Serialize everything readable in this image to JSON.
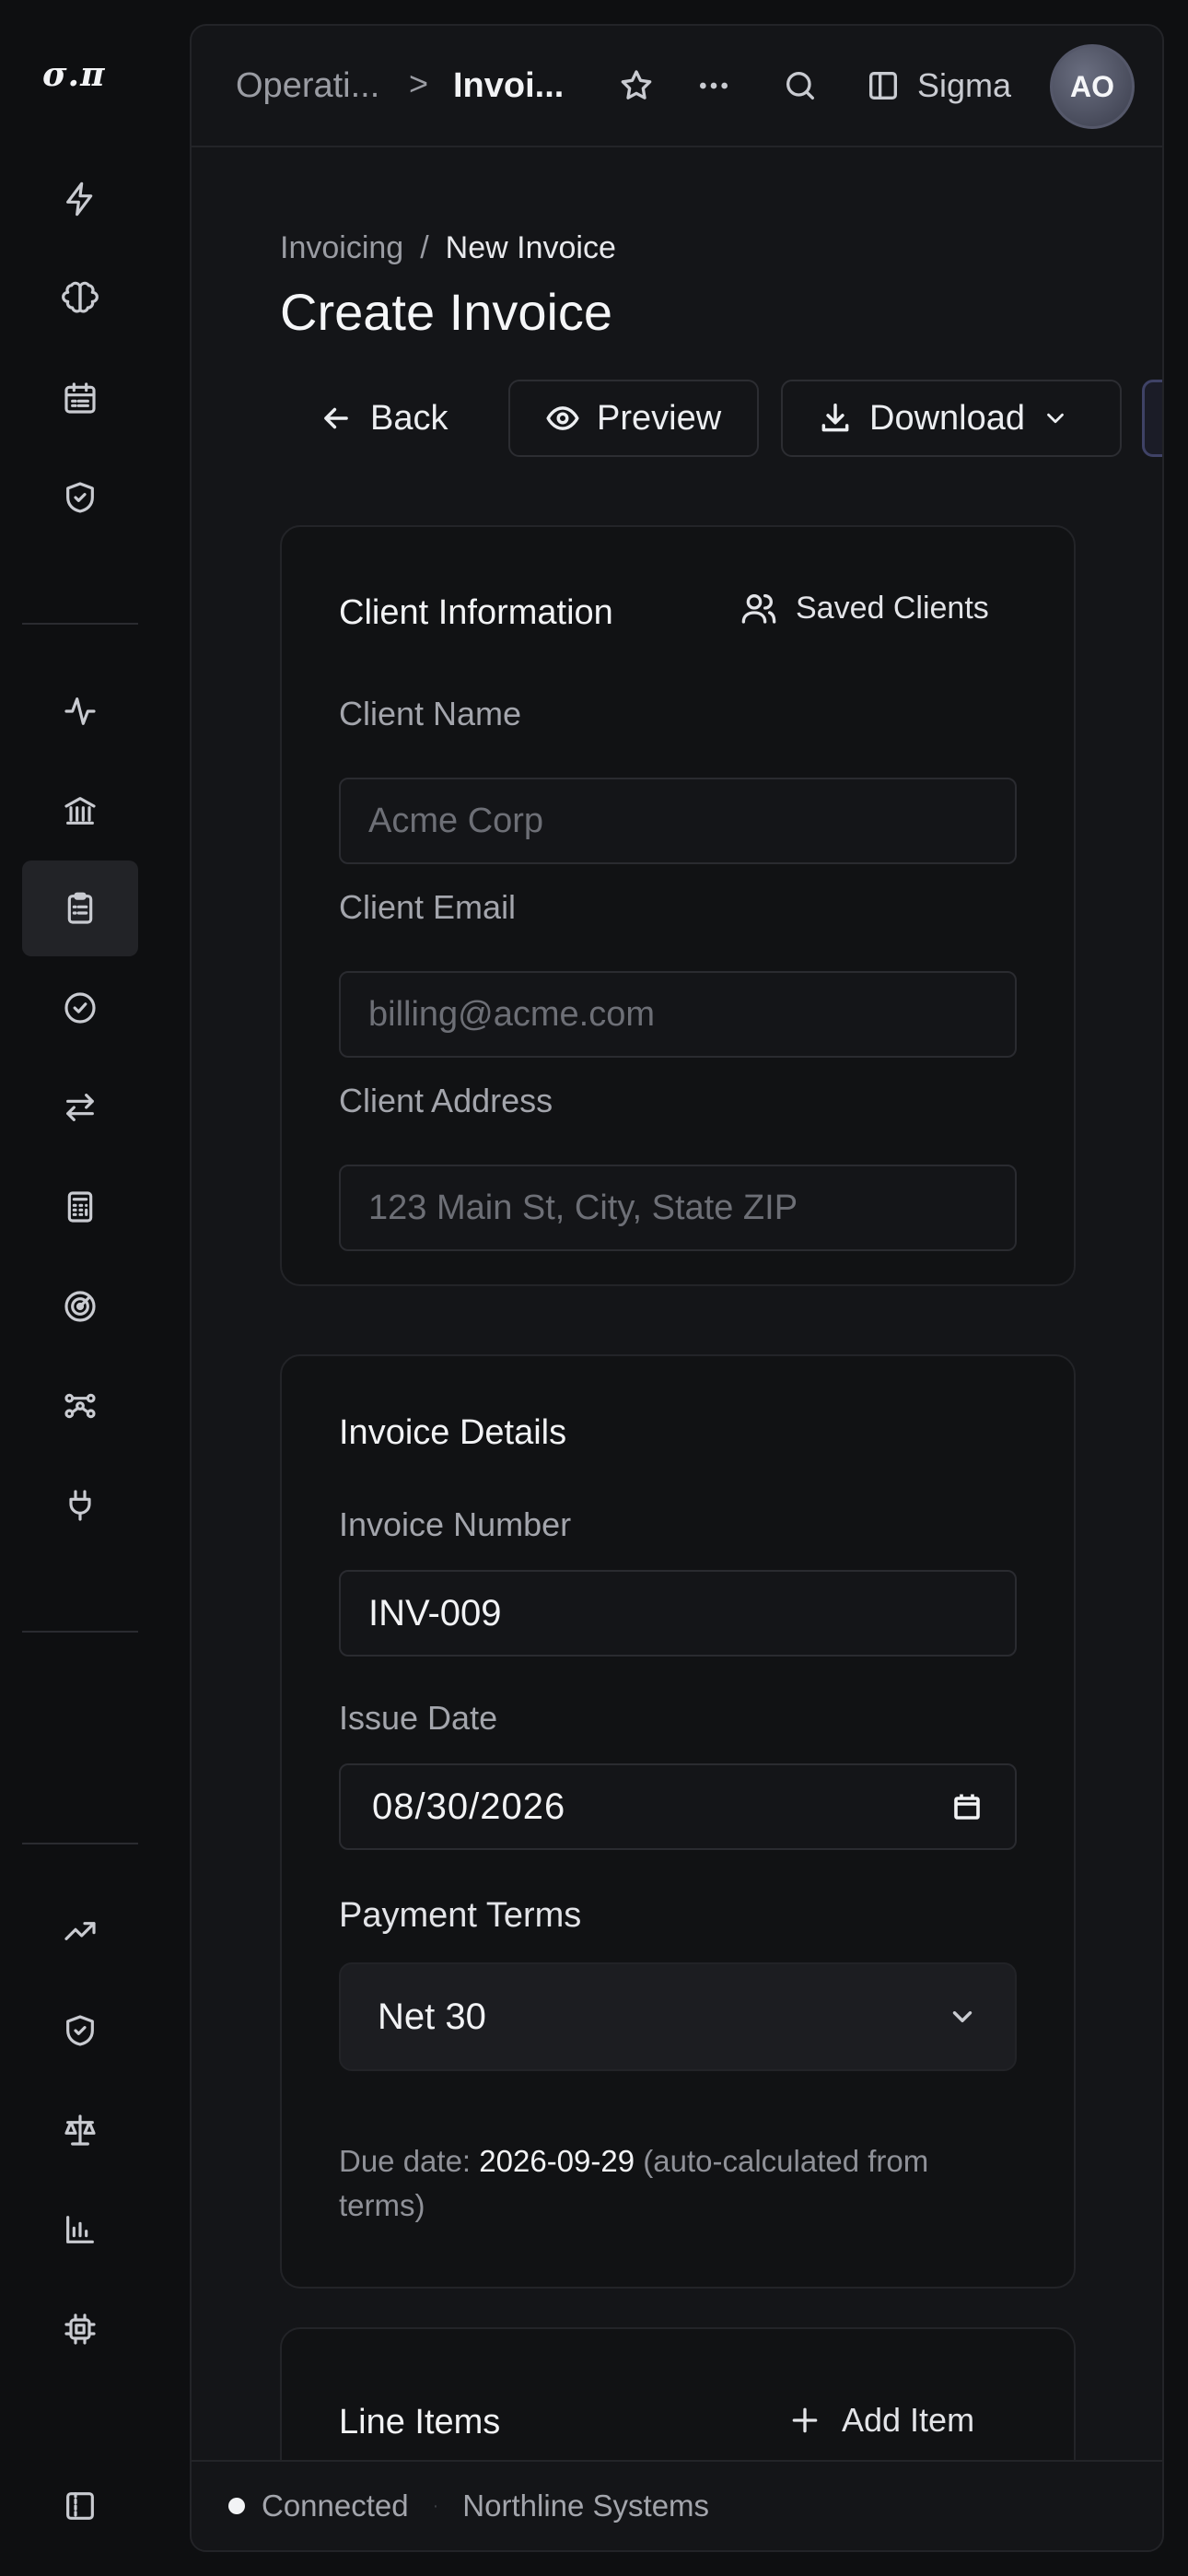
{
  "app": {
    "logo": "σ.π"
  },
  "topbar": {
    "crumb_parent": "Operati...",
    "crumb_sep": ">",
    "crumb_current": "Invoi...",
    "workspace": "Sigma",
    "avatar_initials": "AO"
  },
  "page": {
    "breadcrumb_parent": "Invoicing",
    "breadcrumb_sep": "/",
    "breadcrumb_current": "New Invoice",
    "title": "Create Invoice"
  },
  "actions": {
    "back": "Back",
    "preview": "Preview",
    "download": "Download"
  },
  "client": {
    "title": "Client Information",
    "saved_clients": "Saved Clients",
    "name_label": "Client Name",
    "name_placeholder": "Acme Corp",
    "email_label": "Client Email",
    "email_placeholder": "billing@acme.com",
    "address_label": "Client Address",
    "address_placeholder": "123 Main St, City, State ZIP"
  },
  "details": {
    "title": "Invoice Details",
    "number_label": "Invoice Number",
    "number_value": "INV-009",
    "issue_label": "Issue Date",
    "issue_value": "08/30/2026",
    "terms_label": "Payment Terms",
    "terms_value": "Net 30",
    "due_prefix": "Due date:",
    "due_value": "2026-09-29",
    "due_suffix": "(auto-calculated from terms)"
  },
  "line_items": {
    "title": "Line Items",
    "add_item": "Add Item"
  },
  "status": {
    "connection": "Connected",
    "sep": "·",
    "org": "Northline Systems"
  }
}
